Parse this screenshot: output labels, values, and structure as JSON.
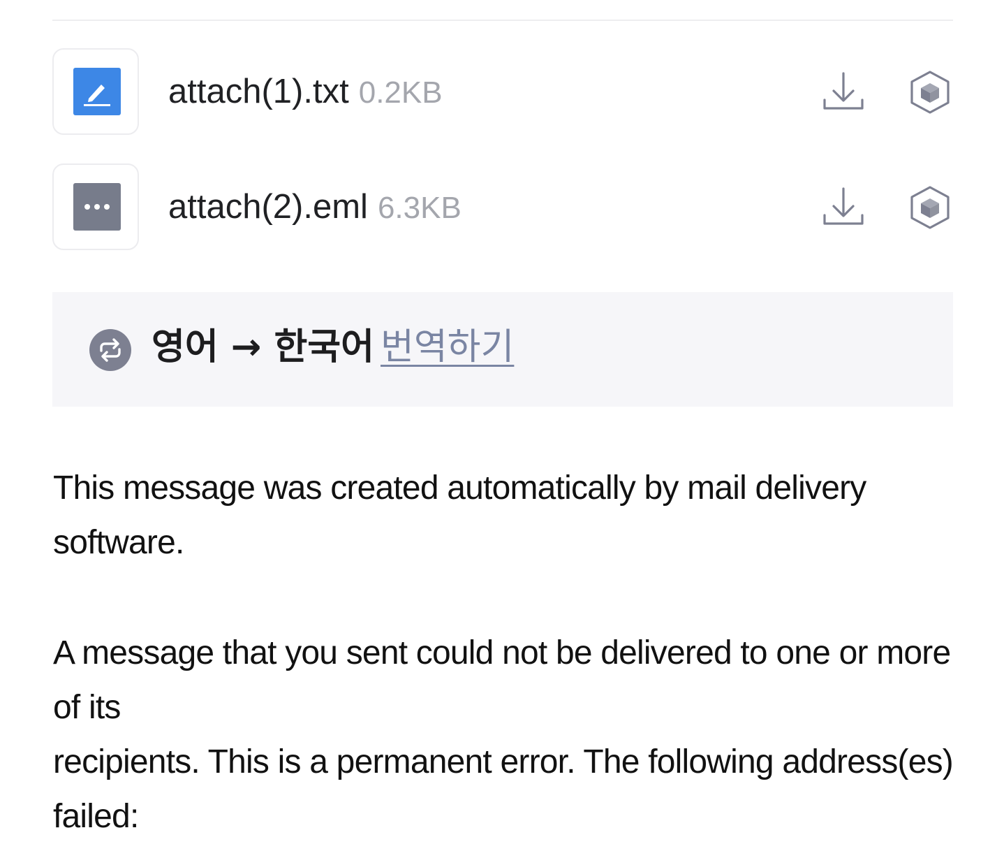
{
  "attachments": [
    {
      "name": "attach(1).txt",
      "size": "0.2KB",
      "icon": "text-file-pencil-icon",
      "icon_color": "#3d87e6"
    },
    {
      "name": "attach(2).eml",
      "size": "6.3KB",
      "icon": "email-file-dots-icon",
      "icon_color": "#777c8b"
    }
  ],
  "translate": {
    "source_target": "영어 → 한국어",
    "link_label": "번역하기",
    "icon": "translate-icon",
    "icon_color": "#7d8091"
  },
  "body": {
    "paragraph1": "This message was created automatically by mail delivery software.",
    "paragraph2_line1": "A message that you sent could not be delivered to one or more of its",
    "paragraph2_line2": "recipients. This is a permanent error. The following address(es) failed:"
  },
  "colors": {
    "action_icon": "#7d8091",
    "link": "#7a85a3",
    "translate_bg": "#f6f6f9"
  }
}
